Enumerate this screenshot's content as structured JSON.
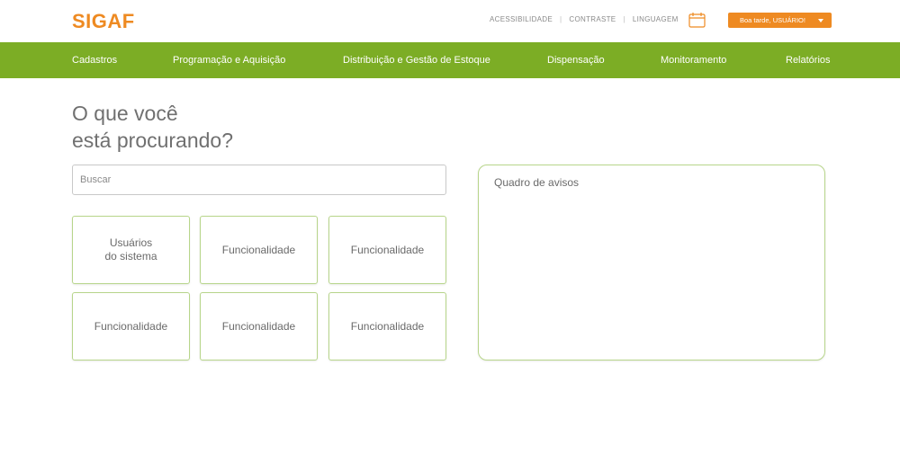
{
  "header": {
    "logo": "SIGAF",
    "links": [
      "ACESSIBILIDADE",
      "CONTRASTE",
      "LINGUAGEM"
    ],
    "user_button": "Boa tarde, USUÁRIO!",
    "icons": {
      "calendar": "calendar-icon",
      "caret": "caret-down-icon"
    }
  },
  "nav": {
    "items": [
      "Cadastros",
      "Programação e Aquisição",
      "Distribuição e Gestão de Estoque",
      "Dispensação",
      "Monitoramento",
      "Relatórios"
    ]
  },
  "main": {
    "headline_line1": "O que você",
    "headline_line2": "está procurando?",
    "search_placeholder": "Buscar",
    "tiles": [
      "Usuários\ndo sistema",
      "Funcionalidade",
      "Funcionalidade",
      "Funcionalidade",
      "Funcionalidade",
      "Funcionalidade"
    ],
    "board_title": "Quadro de avisos"
  },
  "colors": {
    "brand": "#ee8a22",
    "nav": "#7cad25",
    "tile_border": "#b7d58a"
  }
}
